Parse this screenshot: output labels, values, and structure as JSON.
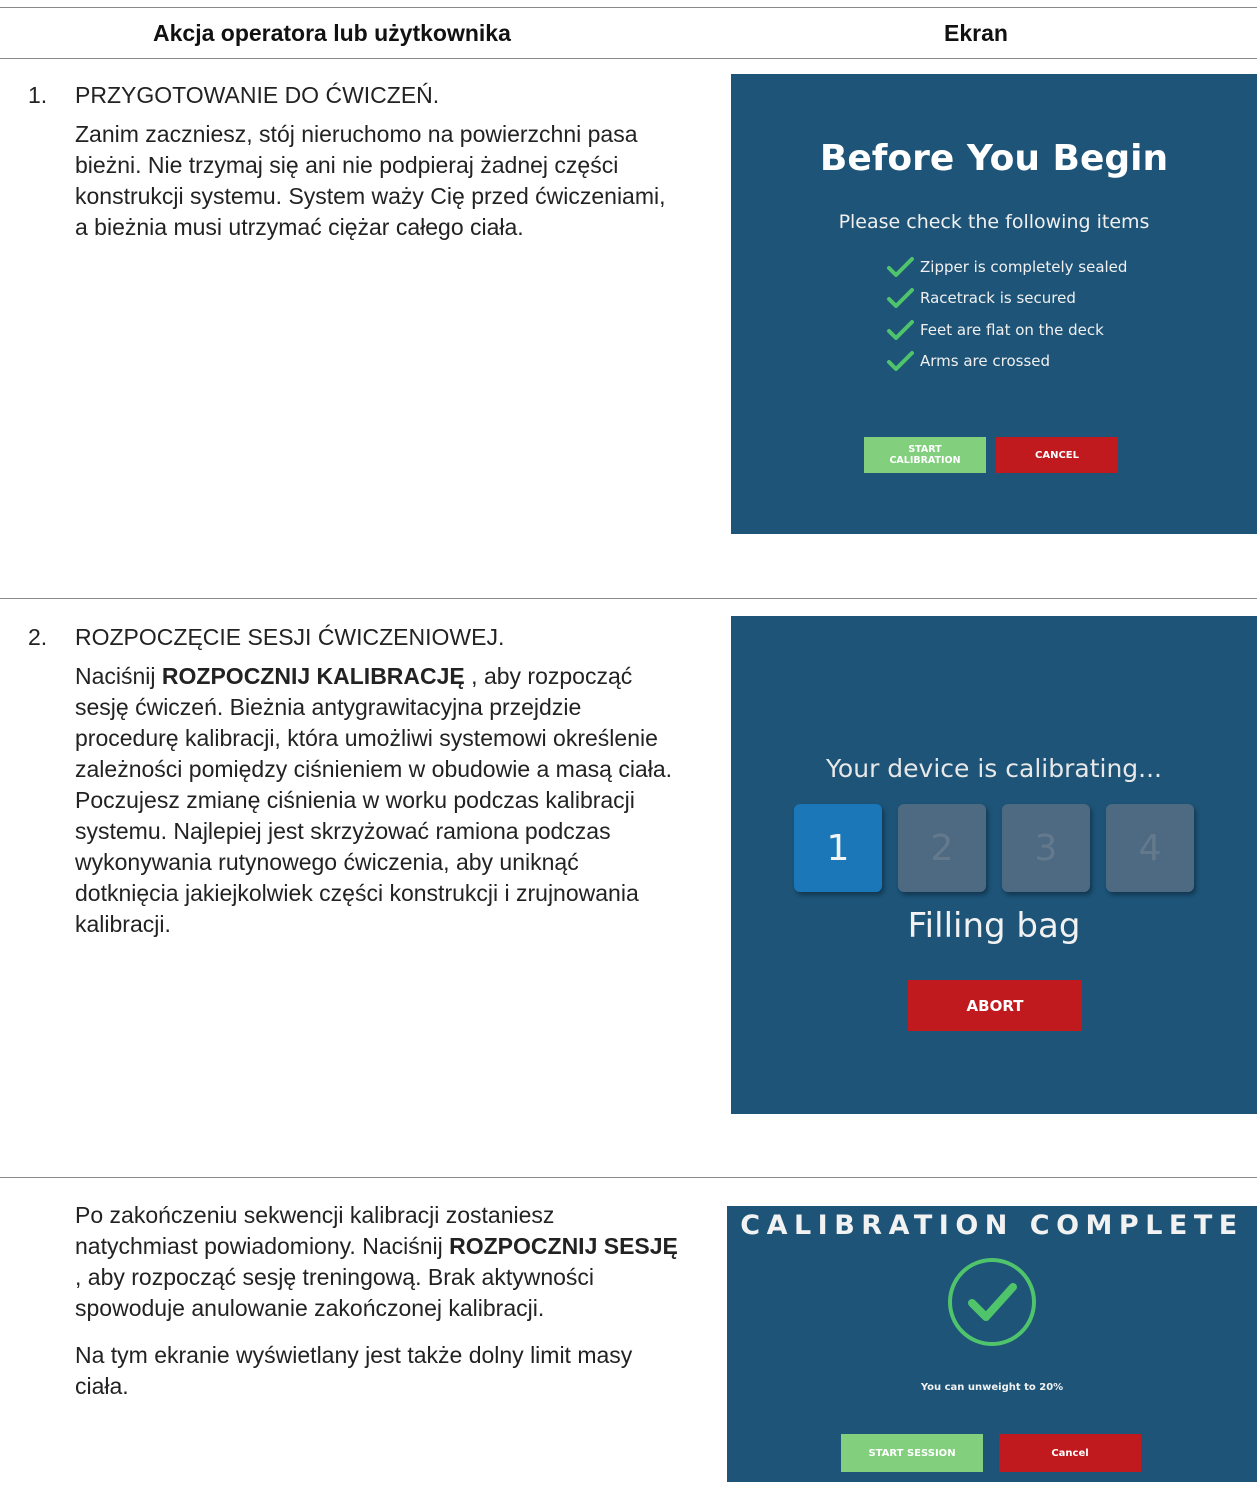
{
  "table": {
    "header": {
      "action": "Akcja operatora lub użytkownika",
      "screen": "Ekran"
    }
  },
  "steps": [
    {
      "number": "1.",
      "title": "PRZYGOTOWANIE DO ĆWICZEŃ.",
      "body": "Zanim zaczniesz, stój nieruchomo na powierzchni pasa bieżni. Nie trzymaj się ani nie podpieraj żadnej części konstrukcji systemu. System waży Cię przed ćwiczeniami, a bieżnia musi utrzymać ciężar całego ciała."
    },
    {
      "number": "2.",
      "title": "ROZPOCZĘCIE SESJI ĆWICZENIOWEJ.",
      "body_prefix": "Naciśnij ",
      "body_bold": "ROZPOCZNIJ KALIBRACJĘ",
      "body_suffix": " , aby rozpocząć sesję ćwiczeń. Bieżnia antygrawitacyjna przejdzie procedurę kalibracji, która umożliwi systemowi określenie zależności pomiędzy ciśnieniem w obudowie a masą ciała. Poczujesz zmianę ciśnienia w worku podczas kalibracji systemu. Najlepiej jest skrzyżować ramiona podczas wykonywania rutynowego ćwiczenia, aby uniknąć dotknięcia jakiejkolwiek części konstrukcji i zrujnowania kalibracji."
    },
    {
      "p1_prefix": "Po zakończeniu sekwencji kalibracji zostaniesz natychmiast powiadomiony. Naciśnij ",
      "p1_bold": "ROZPOCZNIJ SESJĘ",
      "p1_suffix": " , aby rozpocząć sesję treningową. Brak aktywności spowoduje anulowanie zakończonej kalibracji.",
      "p2": "Na tym ekranie wyświetlany jest także dolny limit masy ciała."
    }
  ],
  "screen1": {
    "title": "Before You Begin",
    "subtitle": "Please check the following items",
    "checklist": [
      "Zipper is completely sealed",
      "Racetrack is secured",
      "Feet are flat on the deck",
      "Arms are crossed"
    ],
    "start_button": "START\nCALIBRATION",
    "cancel_button": "CANCEL"
  },
  "screen2": {
    "title": "Your device is calibrating...",
    "steps": [
      "1",
      "2",
      "3",
      "4"
    ],
    "active_step": 1,
    "status": "Filling bag",
    "abort_button": "ABORT"
  },
  "screen3": {
    "title": "CALIBRATION COMPLETE",
    "note": "You can unweight to 20%",
    "start_button": "START SESSION",
    "cancel_button": "Cancel"
  },
  "colors": {
    "screen_bg": "#1d5478",
    "check_green": "#4fc46a",
    "button_green": "#82d07e",
    "button_red": "#c01a1e",
    "tile_active": "#1b77b8",
    "tile_idle": "#4d6a82"
  },
  "icons": {
    "checklist_item": "checkmark-icon",
    "complete": "check-circle-icon"
  }
}
